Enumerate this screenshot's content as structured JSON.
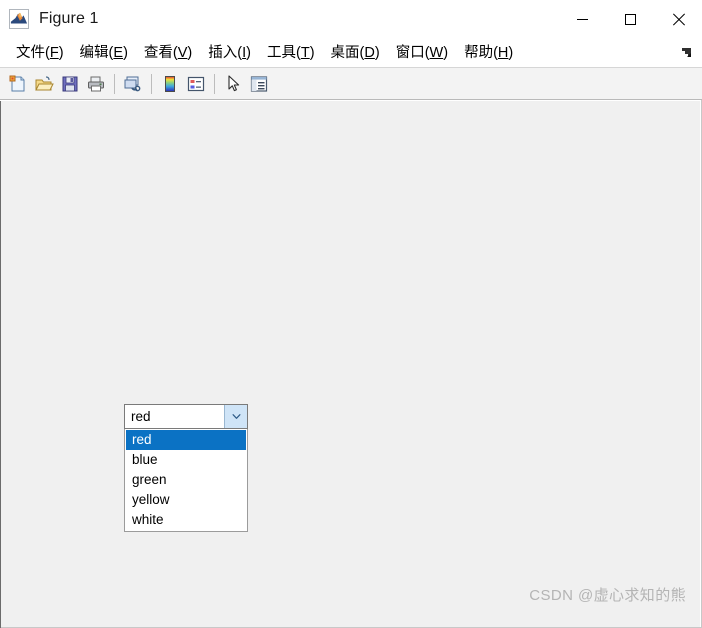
{
  "window": {
    "title": "Figure 1",
    "app_icon": "matlab-logo-icon",
    "controls": {
      "minimize": "minimize-icon",
      "maximize": "maximize-icon",
      "close": "close-icon"
    }
  },
  "menubar": {
    "items": [
      {
        "label": "文件",
        "accel": "F"
      },
      {
        "label": "编辑",
        "accel": "E"
      },
      {
        "label": "查看",
        "accel": "V"
      },
      {
        "label": "插入",
        "accel": "I"
      },
      {
        "label": "工具",
        "accel": "T"
      },
      {
        "label": "桌面",
        "accel": "D"
      },
      {
        "label": "窗口",
        "accel": "W"
      },
      {
        "label": "帮助",
        "accel": "H"
      }
    ],
    "dock_control": "undock-arrow-icon"
  },
  "toolbar": {
    "buttons": [
      {
        "name": "new-figure-icon",
        "tooltip": "新建图窗"
      },
      {
        "name": "open-file-icon",
        "tooltip": "打开文件"
      },
      {
        "name": "save-figure-icon",
        "tooltip": "保存图窗"
      },
      {
        "name": "print-figure-icon",
        "tooltip": "打印图窗"
      },
      {
        "name": "link-plot-icon",
        "tooltip": "链接绘图"
      },
      {
        "name": "colorbar-icon",
        "tooltip": "插入颜色栏"
      },
      {
        "name": "legend-icon",
        "tooltip": "插入图例"
      },
      {
        "name": "edit-plot-arrow-icon",
        "tooltip": "编辑绘图"
      },
      {
        "name": "property-editor-icon",
        "tooltip": "打开属性检查器"
      }
    ]
  },
  "figure": {
    "background_color": "#f0f0f0",
    "dropdown": {
      "name": "color-popupmenu",
      "selected": "red",
      "expanded": true,
      "options": [
        "red",
        "blue",
        "green",
        "yellow",
        "white"
      ],
      "highlight_color": "#0b72c4",
      "highlight_text_color": "#ffffff"
    }
  },
  "watermark": {
    "text": "CSDN @虚心求知的熊"
  }
}
